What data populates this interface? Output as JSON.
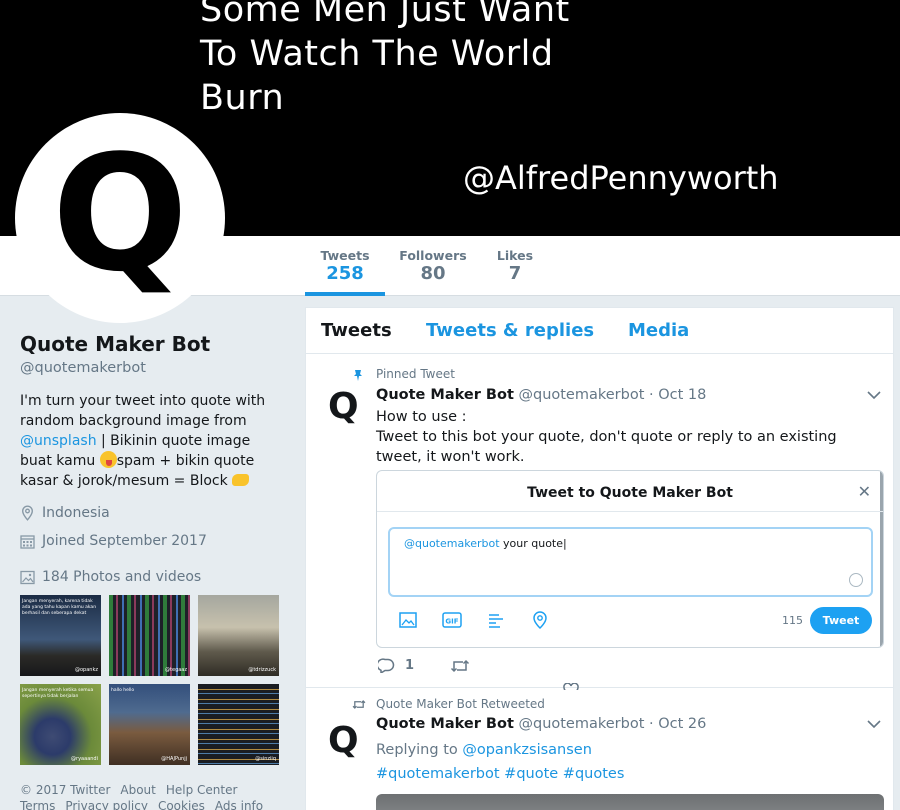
{
  "banner": {
    "quote": "Some Men Just Want\nTo Watch The World\nBurn",
    "handle": "@AlfredPennyworth"
  },
  "avatar": {
    "letter": "Q"
  },
  "stats": [
    {
      "label": "Tweets",
      "value": "258"
    },
    {
      "label": "Followers",
      "value": "80"
    },
    {
      "label": "Likes",
      "value": "7"
    }
  ],
  "profile": {
    "name": "Quote Maker Bot",
    "handle": "@quotemakerbot",
    "bio_part1": "I'm turn your tweet into quote with random background image from ",
    "bio_link": "@unsplash",
    "bio_part2": " | Bikinin quote image buat kamu ",
    "bio_part3": "spam + bikin quote kasar & jorok/mesum = Block ",
    "location": "Indonesia",
    "joined": "Joined September 2017",
    "photos": "184 Photos and videos"
  },
  "thumbs": [
    {
      "text": "Jangan menyerah, karena tidak ada yang tahu kapan kamu akan berhasil dan seberapa dekat",
      "watermark": "@opankz"
    },
    {
      "text": "",
      "watermark": "@tegaaz"
    },
    {
      "text": "",
      "watermark": "@tdrizzuck"
    },
    {
      "text": "Jangan menyerah ketika semua sepertinya tidak berjalan",
      "watermark": "@ryaaandi"
    },
    {
      "text": "hallo hello",
      "watermark": "@HAJPunjj"
    },
    {
      "text": "",
      "watermark": "@sinziiq"
    }
  ],
  "footer": {
    "line1": [
      "© 2017 Twitter",
      "About",
      "Help Center"
    ],
    "line2": [
      "Terms",
      "Privacy policy",
      "Cookies",
      "Ads info"
    ]
  },
  "tabs": [
    "Tweets",
    "Tweets & replies",
    "Media"
  ],
  "tweets": [
    {
      "context": "Pinned Tweet",
      "avatar": "Q",
      "name": "Quote Maker Bot",
      "handle": "@quotemakerbot",
      "date": "· Oct 18",
      "line1": "How to use :",
      "line2": "Tweet to this bot your quote, don't quote or reply to an existing tweet, it won't work.",
      "embed": {
        "title": "Tweet to Quote Maker Bot",
        "mention": "@quotemakerbot",
        "text": " your quote",
        "count": "115",
        "button": "Tweet"
      },
      "reply_count": "1"
    },
    {
      "context": "Quote Maker Bot Retweeted",
      "avatar": "Q",
      "name": "Quote Maker Bot",
      "handle": "@quotemakerbot",
      "date": "· Oct 26",
      "replying_label": "Replying to ",
      "replying_to": "@opankzsisansen",
      "hashtags": "#quotemakerbot #quote #quotes"
    }
  ],
  "colors": {
    "accent": "#1b95e0",
    "banner": "#000000",
    "page_bg": "#e6ecf0"
  }
}
